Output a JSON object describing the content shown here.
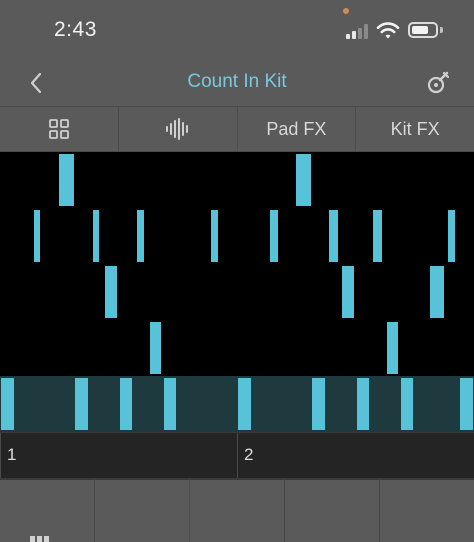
{
  "status_bar": {
    "time": "2:43",
    "recording_dot_color": "#d08a55",
    "signal_icon": "cellular-signal-icon",
    "wifi_icon": "wifi-icon",
    "battery_icon": "battery-icon"
  },
  "nav": {
    "title": "Count In Kit",
    "back_icon": "chevron-left-icon",
    "settings_icon": "tuning-fork-icon"
  },
  "tabs": [
    {
      "label": "",
      "icon": "grid-icon"
    },
    {
      "label": "",
      "icon": "waveform-icon"
    },
    {
      "label": "Pad FX"
    },
    {
      "label": "Kit FX"
    }
  ],
  "sequencer": {
    "accent_color": "#58c3d8",
    "lane_background_color": "#1e3a3e",
    "lanes": 5,
    "steps": 32,
    "notes": [
      {
        "lane": 0,
        "step": 4,
        "length": 1
      },
      {
        "lane": 0,
        "step": 20,
        "length": 1
      },
      {
        "lane": 1,
        "step": 2,
        "length": 0.4
      },
      {
        "lane": 1,
        "step": 6,
        "length": 0.4
      },
      {
        "lane": 1,
        "step": 9,
        "length": 0.5
      },
      {
        "lane": 1,
        "step": 14,
        "length": 0.5
      },
      {
        "lane": 1,
        "step": 18,
        "length": 0.5
      },
      {
        "lane": 1,
        "step": 22,
        "length": 0.6
      },
      {
        "lane": 1,
        "step": 25,
        "length": 0.6
      },
      {
        "lane": 1,
        "step": 30,
        "length": 0.5
      },
      {
        "lane": 2,
        "step": 7,
        "length": 0.8
      },
      {
        "lane": 2,
        "step": 23,
        "length": 0.8
      },
      {
        "lane": 2,
        "step": 29,
        "length": 0.9
      },
      {
        "lane": 3,
        "step": 10,
        "length": 0.8
      },
      {
        "lane": 3,
        "step": 26,
        "length": 0.8
      },
      {
        "lane": 4,
        "step": 0,
        "length": 0.9
      },
      {
        "lane": 4,
        "step": 5,
        "length": 0.9
      },
      {
        "lane": 4,
        "step": 8,
        "length": 0.8
      },
      {
        "lane": 4,
        "step": 11,
        "length": 0.8
      },
      {
        "lane": 4,
        "step": 16,
        "length": 0.9
      },
      {
        "lane": 4,
        "step": 21,
        "length": 0.9
      },
      {
        "lane": 4,
        "step": 24,
        "length": 0.8
      },
      {
        "lane": 4,
        "step": 27,
        "length": 0.8
      },
      {
        "lane": 4,
        "step": 31,
        "length": 0.9
      }
    ]
  },
  "ruler": {
    "bars": [
      "1",
      "2"
    ]
  },
  "pads": {
    "count": 5,
    "first_icon": "keyboard-grid-icon"
  }
}
